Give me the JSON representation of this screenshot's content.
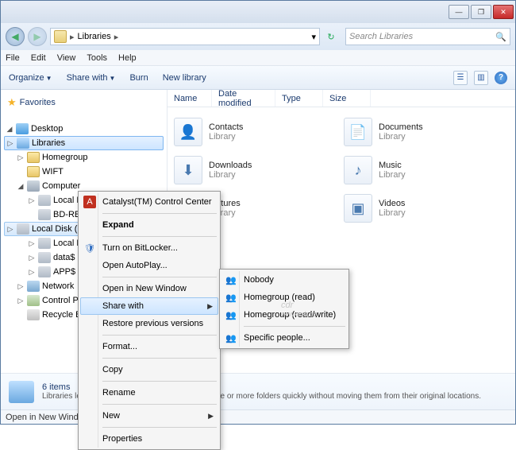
{
  "titlebar": {
    "min": "—",
    "max": "❐",
    "close": "✕"
  },
  "nav": {
    "breadcrumb_root_icon": "libraries",
    "crumb1": "Libraries",
    "sep": "▸",
    "dropdown": "▾",
    "refresh": "↻",
    "search_placeholder": "Search Libraries"
  },
  "menu": {
    "file": "File",
    "edit": "Edit",
    "view": "View",
    "tools": "Tools",
    "help": "Help"
  },
  "cmd": {
    "organize": "Organize",
    "sharewith": "Share with",
    "burn": "Burn",
    "newlib": "New library",
    "views": "☰",
    "preview": "▥",
    "help": "?"
  },
  "cols": {
    "name": "Name",
    "date": "Date modified",
    "type": "Type",
    "size": "Size"
  },
  "libs": [
    {
      "name": "Contacts",
      "sub": "Library",
      "glyph": "👤"
    },
    {
      "name": "Documents",
      "sub": "Library",
      "glyph": "📄"
    },
    {
      "name": "Downloads",
      "sub": "Library",
      "glyph": "⬇"
    },
    {
      "name": "Music",
      "sub": "Library",
      "glyph": "♪"
    },
    {
      "name": "Pictures",
      "sub": "Library",
      "glyph": "▦"
    },
    {
      "name": "Videos",
      "sub": "Library",
      "glyph": "▣"
    }
  ],
  "sidebar": {
    "favorites": "Favorites",
    "nodes": {
      "desktop": "Desktop",
      "libraries": "Libraries",
      "homegroup": "Homegroup",
      "wift": "WIFT",
      "computer": "Computer",
      "localc": "Local Disk (C:)",
      "bdre": "BD-RE Drive (D:)",
      "locale": "Local Disk (E:)",
      "localdis": "Local Dis",
      "datas": "data$ (\\\\",
      "apps": "APP$ (\\\\I",
      "network": "Network",
      "controlp": "Control Pa",
      "recycle": "Recycle Bir"
    }
  },
  "ctx1": {
    "ccc": "Catalyst(TM) Control Center",
    "expand": "Expand",
    "bitlocker": "Turn on BitLocker...",
    "autoplay": "Open AutoPlay...",
    "newwin": "Open in New Window",
    "sharewith": "Share with",
    "restore": "Restore previous versions",
    "format": "Format...",
    "copy": "Copy",
    "rename": "Rename",
    "new": "New",
    "properties": "Properties"
  },
  "ctx2": {
    "nobody": "Nobody",
    "hgread": "Homegroup (read)",
    "hgrw": "Homegroup (read/write)",
    "specific": "Specific people..."
  },
  "detail": {
    "count": "6 items",
    "desc": "Libraries let you access and arrange items from one or more folders quickly without moving them from their original locations."
  },
  "status": "Open in New Window",
  "watermark": {
    "big": "cdr",
    "small": "www.cdr.cz"
  }
}
